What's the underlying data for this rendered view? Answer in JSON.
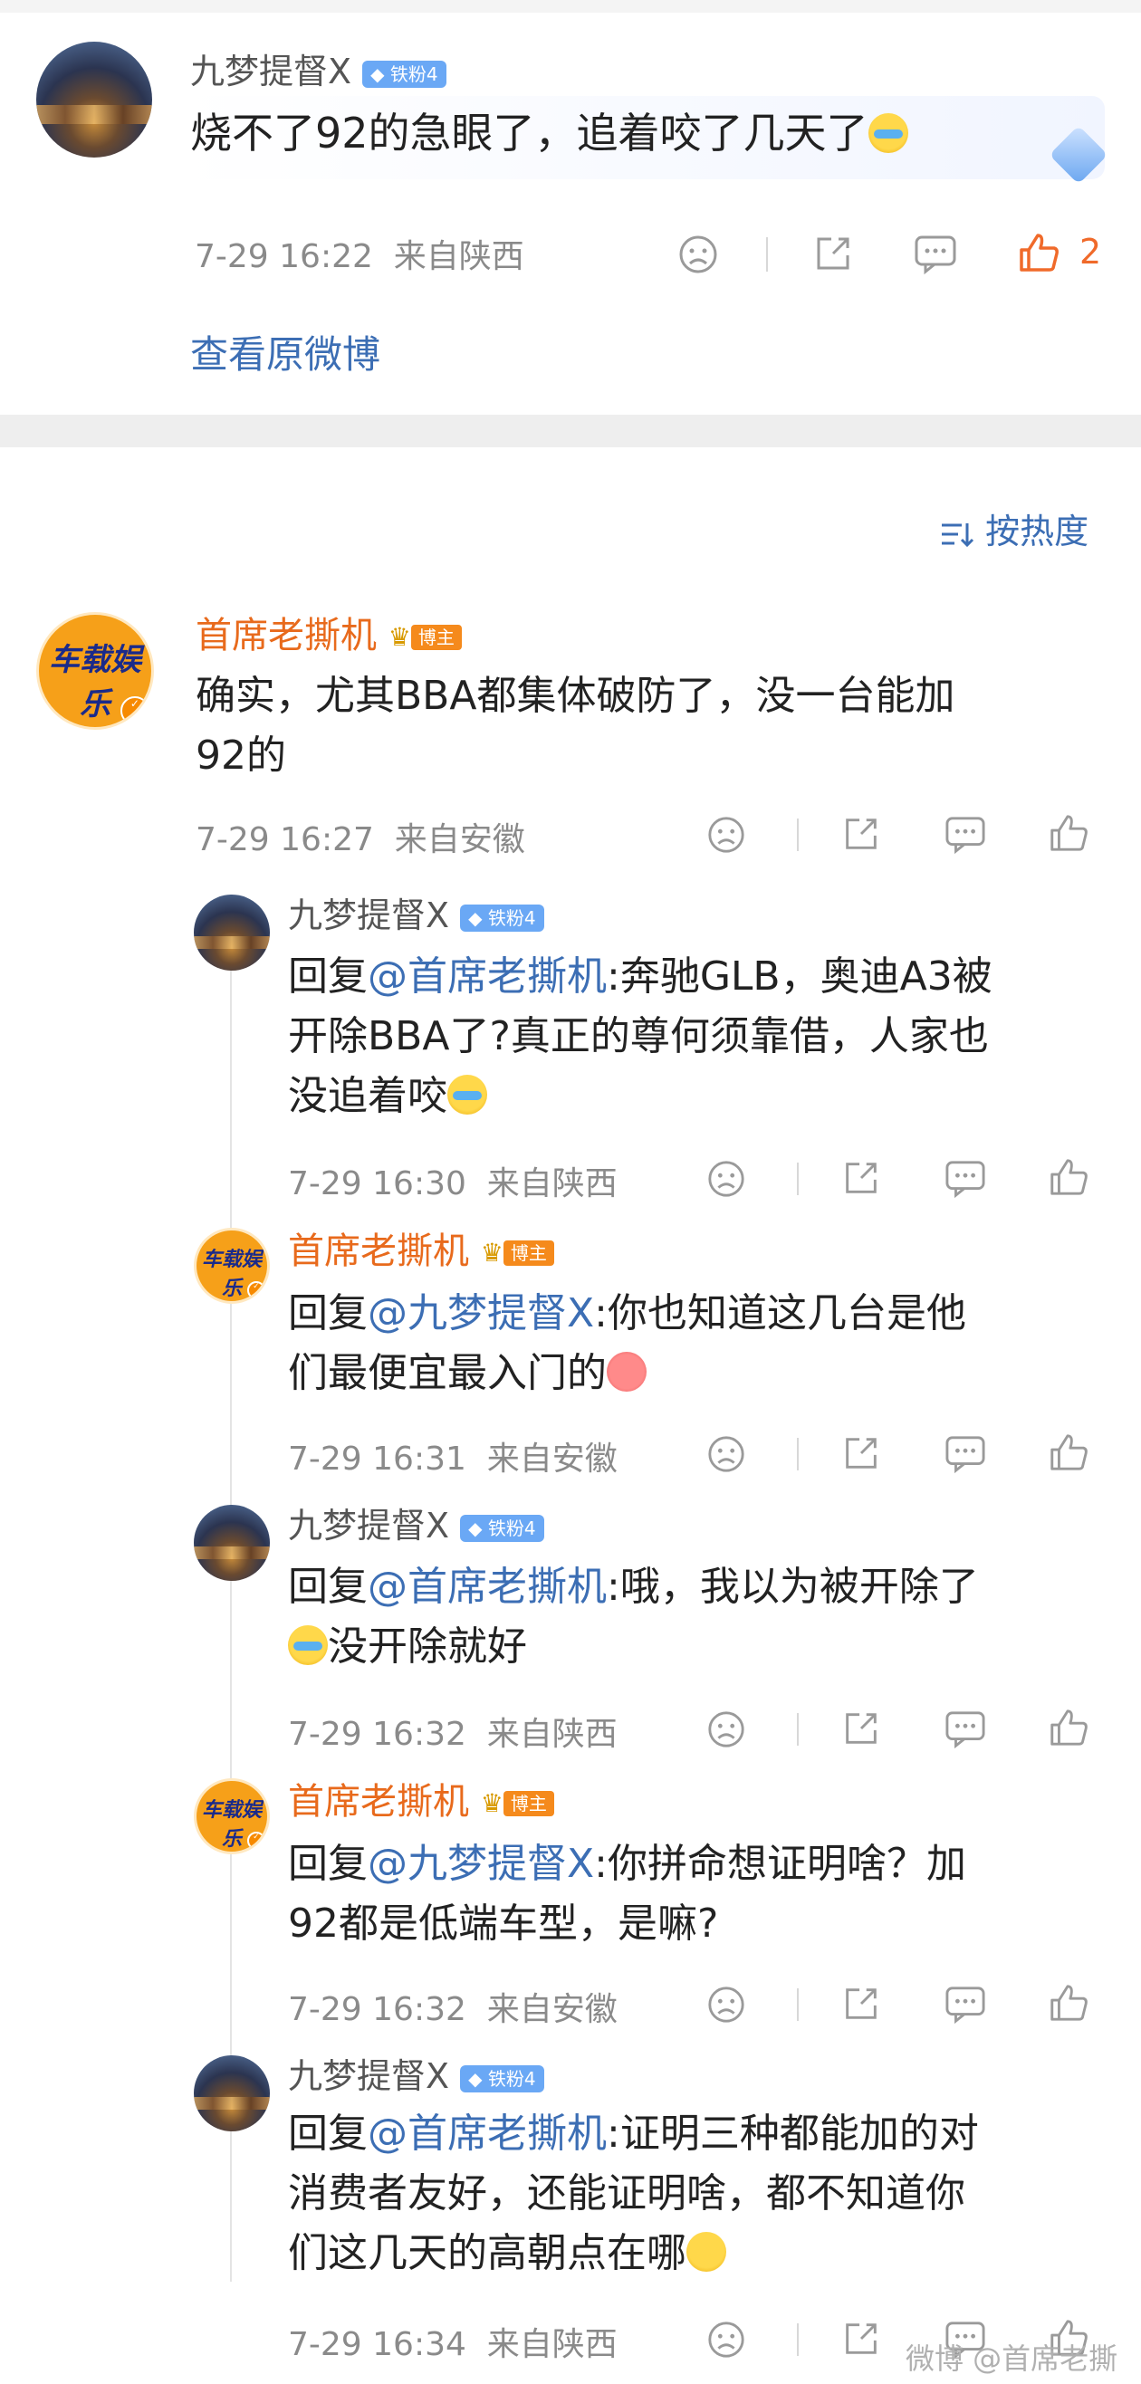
{
  "top_post": {
    "author": "九梦提督X",
    "badge": "铁粉4",
    "text": "烧不了92的急眼了，追着咬了几天了",
    "time": "7-29 16:22",
    "location": "来自陕西",
    "like_count": "2",
    "view_original": "查看原微博"
  },
  "sort_label": "按热度",
  "comment": {
    "author": "首席老撕机",
    "badge": "博主",
    "text_line1": "确实，尤其BBA都集体破防了，没一台能加",
    "text_line2": "92的",
    "time": "7-29 16:27",
    "location": "来自安徽"
  },
  "replies": [
    {
      "author": "九梦提督X",
      "badge": "铁粉4",
      "prefix": "回复",
      "mention": "@首席老撕机",
      "line1_rest": ":奔驰GLB，奥迪A3被",
      "line2": "开除BBA了?真正的尊何须靠借，人家也",
      "line3": "没追着咬",
      "time": "7-29 16:30",
      "location": "来自陕西"
    },
    {
      "author": "首席老撕机",
      "badge": "博主",
      "prefix": "回复",
      "mention": "@九梦提督X",
      "line1_rest": ":你也知道这几台是他",
      "line2": "们最便宜最入门的",
      "time": "7-29 16:31",
      "location": "来自安徽"
    },
    {
      "author": "九梦提督X",
      "badge": "铁粉4",
      "prefix": "回复",
      "mention": "@首席老撕机",
      "line1_rest": ":哦，我以为被开除了",
      "line2": "没开除就好",
      "time": "7-29 16:32",
      "location": "来自陕西"
    },
    {
      "author": "首席老撕机",
      "badge": "博主",
      "prefix": "回复",
      "mention": "@九梦提督X",
      "line1_rest": ":你拼命想证明啥？加",
      "line2": "92都是低端车型，是嘛?",
      "time": "7-29 16:32",
      "location": "来自安徽"
    },
    {
      "author": "九梦提督X",
      "badge": "铁粉4",
      "prefix": "回复",
      "mention": "@首席老撕机",
      "line1_rest": ":证明三种都能加的对",
      "line2": "消费者友好，还能证明啥，都不知道你",
      "line3": "们这几天的高朝点在哪",
      "time": "7-29 16:34",
      "location": "来自陕西"
    }
  ],
  "logo_text": "车载娱乐",
  "watermark": "微博 @首席老撕机",
  "icons": {
    "dislike": "sad-face-icon",
    "share": "share-icon",
    "comment": "comment-bubble-icon",
    "like": "thumbs-up-icon",
    "sort": "sort-lines-icon"
  },
  "colors": {
    "mention": "#3c6eb4",
    "host_name": "#e86a1c",
    "like_active": "#f06a2a",
    "link": "#3c6eb4"
  }
}
